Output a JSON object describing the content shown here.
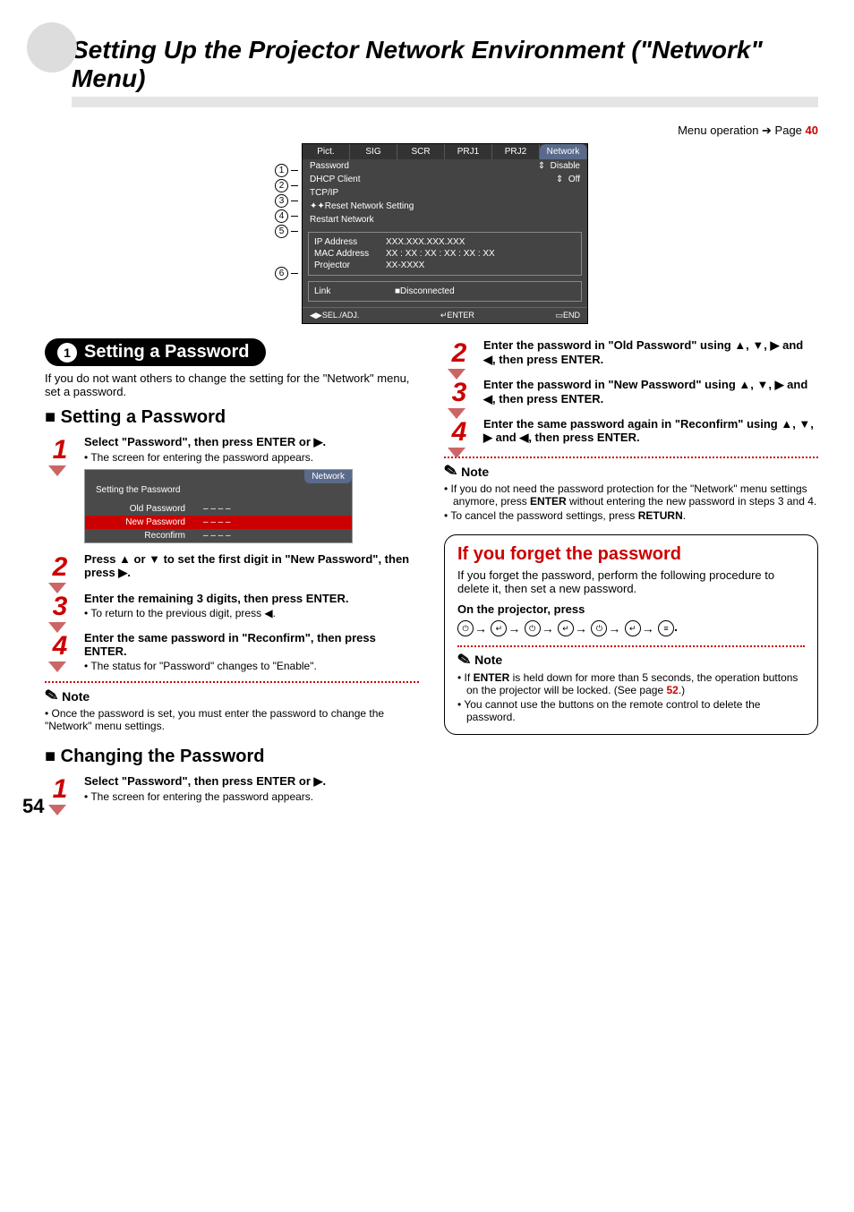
{
  "pageTitle": "Setting Up the Projector Network Environment (\"Network\" Menu)",
  "menuOp": {
    "text": "Menu operation ➔ Page ",
    "page": "40"
  },
  "menuScreen": {
    "tabs": [
      "Pict.",
      "SIG",
      "SCR",
      "PRJ1",
      "PRJ2",
      "Network"
    ],
    "rows": [
      {
        "label": "Password",
        "val": "Disable"
      },
      {
        "label": "DHCP Client",
        "val": "Off"
      },
      {
        "label": "TCP/IP",
        "val": ""
      },
      {
        "label": "Reset Network Setting",
        "val": ""
      },
      {
        "label": "Restart Network",
        "val": ""
      }
    ],
    "info": [
      {
        "k": "IP Address",
        "v": "XXX.XXX.XXX.XXX"
      },
      {
        "k": "MAC Address",
        "v": "XX : XX : XX : XX : XX : XX"
      },
      {
        "k": "Projector",
        "v": "XX-XXXX"
      }
    ],
    "link": {
      "k": "Link",
      "v": "Disconnected"
    },
    "footer": {
      "l": "SEL./ADJ.",
      "c": "ENTER",
      "r": "END"
    }
  },
  "section1": {
    "pillNum": "1",
    "pillText": "Setting a Password",
    "intro": "If you do not want others to change the setting for the \"Network\" menu, set a password.",
    "subhead": "Setting a Password"
  },
  "left_steps": [
    {
      "n": "1",
      "title": "Select \"Password\", then press ENTER or ▶.",
      "sub": "• The screen for entering the password appears."
    },
    {
      "n": "2",
      "title": "Press ▲ or ▼ to set the first digit in \"New Password\", then press ▶.",
      "sub": ""
    },
    {
      "n": "3",
      "title": "Enter the remaining 3 digits, then press ENTER.",
      "sub": "• To return to the previous digit, press ◀."
    },
    {
      "n": "4",
      "title": "Enter the same password in \"Reconfirm\", then press ENTER.",
      "sub": "• The status for \"Password\" changes to \"Enable\"."
    }
  ],
  "pwBox": {
    "tab": "Network",
    "title": "Setting the Password",
    "rows": [
      {
        "label": "Old Password",
        "val": "– – – –",
        "sel": false
      },
      {
        "label": "New Password",
        "val": "– – – –",
        "sel": true
      },
      {
        "label": "Reconfirm",
        "val": "– – – –",
        "sel": false
      }
    ]
  },
  "leftNote": {
    "title": "Note",
    "body": "• Once the password is set, you must enter the password to change the \"Network\" menu settings."
  },
  "changing": {
    "subhead": "Changing the Password",
    "step": {
      "n": "1",
      "title": "Select \"Password\", then press ENTER or ▶.",
      "sub": "• The screen for entering the password appears."
    }
  },
  "right_steps": [
    {
      "n": "2",
      "title": "Enter the password in \"Old Password\" using ▲, ▼, ▶ and ◀, then press ENTER."
    },
    {
      "n": "3",
      "title": "Enter the password in \"New Password\" using ▲, ▼, ▶ and ◀, then press ENTER."
    },
    {
      "n": "4",
      "title": "Enter the same password again in \"Reconfirm\" using ▲, ▼, ▶ and ◀, then press ENTER."
    }
  ],
  "rightNote": {
    "title": "Note",
    "bullets": [
      "If you do not need the password protection for the \"Network\" menu settings anymore, press ENTER without entering the new password in steps 3 and 4.",
      "To cancel the password settings, press RETURN."
    ]
  },
  "forget": {
    "title": "If you forget the password",
    "intro": "If you forget the password, perform the following procedure to delete it, then set a new password.",
    "seqHead": "On the projector, press",
    "seqLabels": [
      "STANDBY/ON",
      "ENTER",
      "STANDBY/ON",
      "ENTER",
      "STANDBY/ON",
      "ENTER",
      "MENU"
    ],
    "noteTitle": "Note",
    "bullets": [
      "If ENTER is held down for more than 5 seconds, the operation buttons on the projector will be locked. (See page 52.)",
      "You cannot use the buttons on the remote control to delete the password."
    ],
    "pageRef": "52"
  },
  "pageNum": "54"
}
